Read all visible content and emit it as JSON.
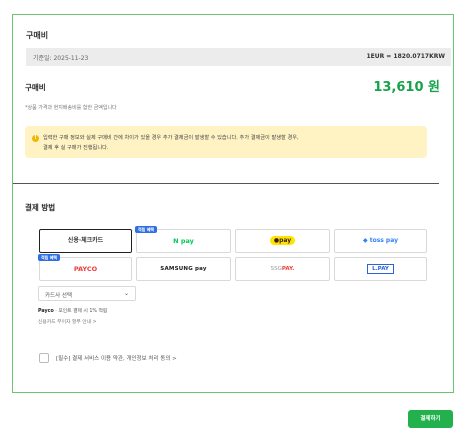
{
  "section_title": "구매비",
  "rate": {
    "date_label": "기준일: 2025-11-23",
    "value": "1EUR = 1820.0717KRW"
  },
  "price": {
    "label": "구매비",
    "amount": "13,610 원",
    "note": "*상품 가격과 현지배송비를 합한 금액입니다"
  },
  "notice": {
    "icon": "info-icon",
    "line1": "입력한 구매 정보와 실제 구매비 간에 차이가 있을 경우 추가 결제금이 발생할 수 있습니다. 추가 결제금이 발생할 경우,",
    "line2": "결제 후 실 구매가 진행됩니다."
  },
  "payment": {
    "title": "결제 방법",
    "methods": [
      {
        "label": "신용·체크카드",
        "selected": true,
        "badge": ""
      },
      {
        "label": "pay",
        "badge": "적립 혜택"
      },
      {
        "label": "pay",
        "badge": ""
      },
      {
        "label": "toss pay",
        "badge": ""
      },
      {
        "label": "PAYCO",
        "badge": "적립 혜택"
      },
      {
        "label": "SAMSUNG pay",
        "badge": ""
      },
      {
        "label": "SSGPAY.",
        "badge": ""
      },
      {
        "label": "L.PAY",
        "badge": ""
      }
    ],
    "card_select": "카드사 선택",
    "payco_note_brand": "Payco",
    "payco_note_rest": " · 포인트 결제 시 1% 적립",
    "card_link": "신용카드 무이자 할부 안내 >"
  },
  "agree": "[필수] 결제 서비스 이용 약관, 개인정보 처리 동의 >",
  "pay_button": "결제하기",
  "colors": {
    "accent_green": "#16a34a",
    "panel_border": "#6cc46f",
    "notice_bg": "#fff3c4",
    "badge_blue": "#2f6fe4"
  }
}
